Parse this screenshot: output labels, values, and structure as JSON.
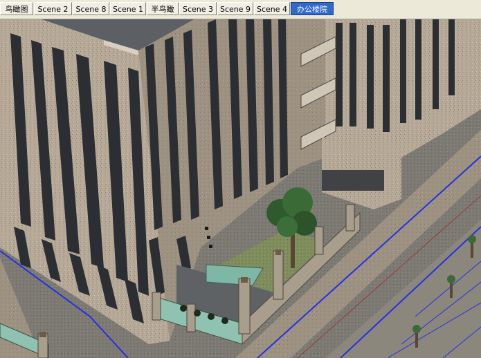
{
  "tabs": [
    {
      "label": "鸟瞰图",
      "active": false
    },
    {
      "label": "Scene 2",
      "active": false
    },
    {
      "label": "Scene 8",
      "active": false
    },
    {
      "label": "Scene 1",
      "active": false
    },
    {
      "label": "半鸟瞰",
      "active": false
    },
    {
      "label": "Scene 3",
      "active": false
    },
    {
      "label": "Scene 9",
      "active": false
    },
    {
      "label": "Scene 4",
      "active": false
    },
    {
      "label": "办公楼院",
      "active": true
    }
  ],
  "colors": {
    "facade": "#b6a897",
    "facade_shadow": "#8f8374",
    "window": "#2b2e33",
    "road": "#7f7c75",
    "lawn": "#7e8c5a",
    "glass": "#7fb7a6",
    "road_edge": "#2430e6",
    "active_tab": "#3169c6"
  }
}
